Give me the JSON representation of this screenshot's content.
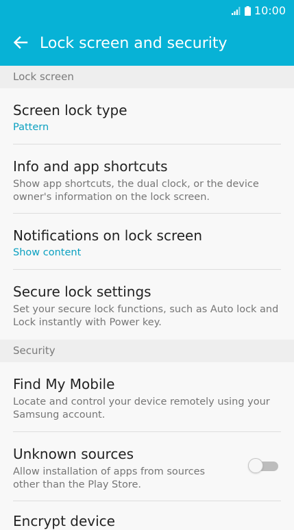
{
  "status_bar": {
    "time": "10:00",
    "icons": [
      "signal-icon",
      "battery-icon"
    ]
  },
  "app_bar": {
    "back_icon": "arrow-left-icon",
    "title": "Lock screen and security"
  },
  "sections": {
    "lock_screen": {
      "header": "Lock screen",
      "items": [
        {
          "title": "Screen lock type",
          "subtitle": "Pattern"
        },
        {
          "title": "Info and app shortcuts",
          "subtitle": "Show app shortcuts, the dual clock, or the device owner's information on the lock screen."
        },
        {
          "title": "Notifications on lock screen",
          "subtitle": "Show content"
        },
        {
          "title": "Secure lock settings",
          "subtitle": "Set your secure lock functions, such as Auto lock and Lock instantly with Power key."
        }
      ]
    },
    "security": {
      "header": "Security",
      "items": [
        {
          "title": "Find My Mobile",
          "subtitle": "Locate and control your device remotely using your Samsung account."
        },
        {
          "title": "Unknown sources",
          "subtitle": "Allow installation of apps from sources other than the Play Store.",
          "toggle_on": false
        },
        {
          "title": "Encrypt device"
        }
      ]
    }
  },
  "colors": {
    "accent": "#07b2d6",
    "accent_text": "#0aa0c0"
  }
}
